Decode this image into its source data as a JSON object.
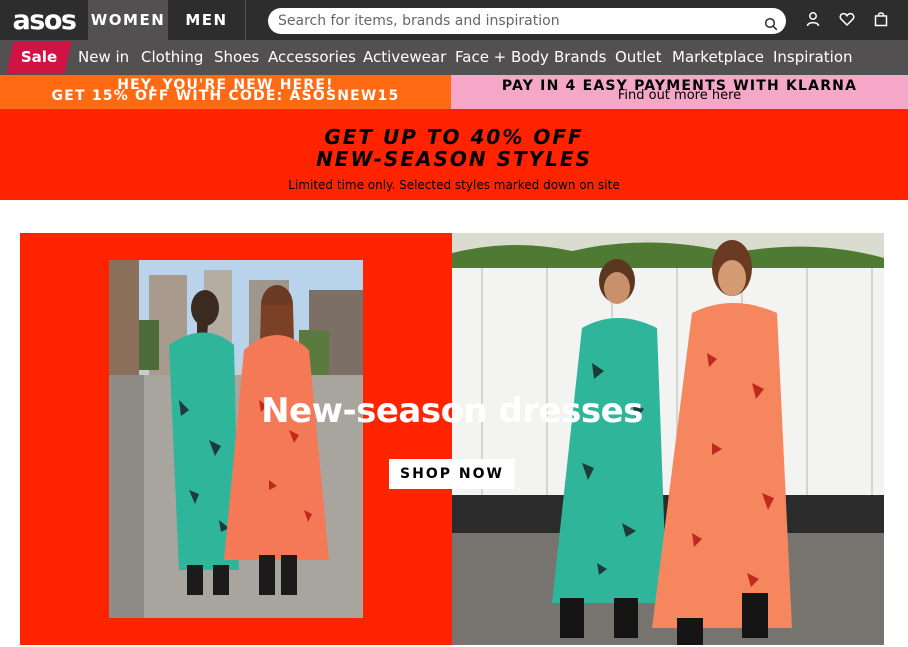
{
  "header": {
    "logo": "asos",
    "women_label": "WOMEN",
    "men_label": "MEN",
    "search_placeholder": "Search for items, brands and inspiration",
    "icons": [
      "search-icon",
      "account-icon",
      "heart-icon",
      "bag-icon"
    ]
  },
  "nav": {
    "sale_label": "Sale",
    "items": [
      "New in",
      "Clothing",
      "Shoes",
      "Accessories",
      "Activewear",
      "Face + Body",
      "Brands",
      "Outlet",
      "Marketplace",
      "Inspiration"
    ]
  },
  "promo": {
    "left_line1": "HEY, YOU'RE NEW HERE!",
    "left_line2": "GET 15% OFF WITH CODE: ASOSNEW15",
    "right_line1": "PAY IN 4 EASY PAYMENTS WITH KLARNA",
    "right_line2": "Find out more here"
  },
  "sale_banner": {
    "line1": "GET UP TO 40% OFF",
    "line2": "NEW-SEASON STYLES",
    "sub": "Limited time only. Selected styles marked down on site"
  },
  "hero": {
    "title": "New-season dresses",
    "button_label": "SHOP NOW"
  },
  "colors": {
    "header_bg": "#2d2d2d",
    "nav_bg": "#525050",
    "sale_red": "#d01345",
    "promo_orange": "#ff6a13",
    "promo_pink": "#f4a7c6",
    "banner_red": "#ff2300"
  }
}
